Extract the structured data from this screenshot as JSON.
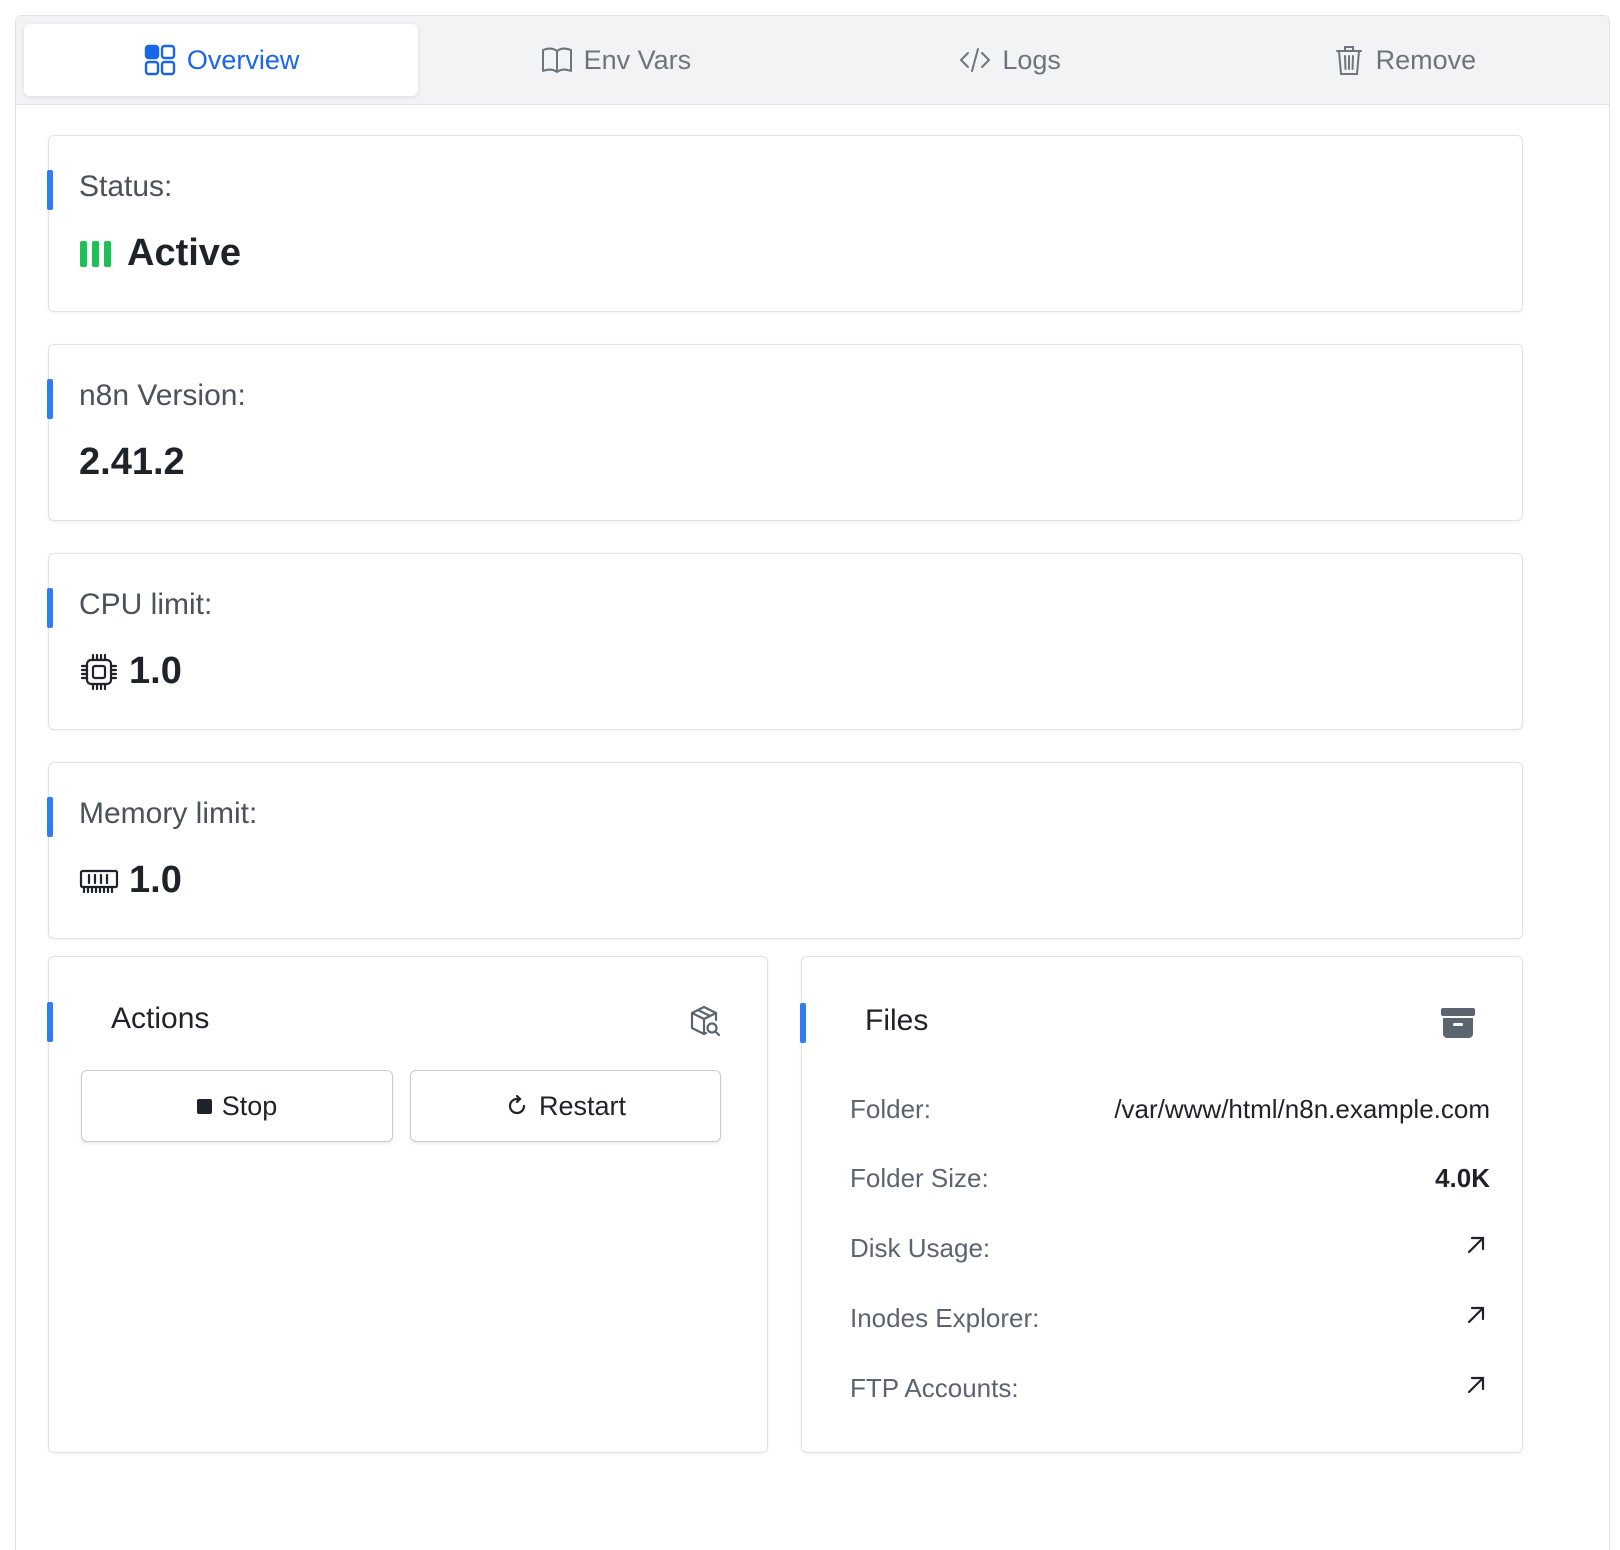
{
  "tabs": [
    {
      "label": "Overview",
      "icon": "grid-icon",
      "active": true
    },
    {
      "label": "Env Vars",
      "icon": "book-icon",
      "active": false
    },
    {
      "label": "Logs",
      "icon": "code-icon",
      "active": false
    },
    {
      "label": "Remove",
      "icon": "trash-icon",
      "active": false
    }
  ],
  "status": {
    "label": "Status:",
    "value": "Active",
    "color": "#1fc056"
  },
  "version": {
    "label": "n8n Version:",
    "value": "2.41.2"
  },
  "cpu": {
    "label": "CPU limit:",
    "value": "1.0",
    "icon": "cpu-icon"
  },
  "memory": {
    "label": "Memory limit:",
    "value": "1.0",
    "icon": "memory-icon"
  },
  "actions": {
    "title": "Actions",
    "icon": "package-search-icon",
    "stop_label": "Stop",
    "restart_label": "Restart"
  },
  "files": {
    "title": "Files",
    "icon": "archive-icon",
    "folder_label": "Folder:",
    "folder_value": "/var/www/html/n8n.example.com",
    "size_label": "Folder Size:",
    "size_value": "4.0K",
    "disk_label": "Disk Usage:",
    "inodes_label": "Inodes Explorer:",
    "ftp_label": "FTP Accounts:"
  },
  "colors": {
    "accent": "#2f7df6",
    "active_tab": "#1a66e8"
  }
}
